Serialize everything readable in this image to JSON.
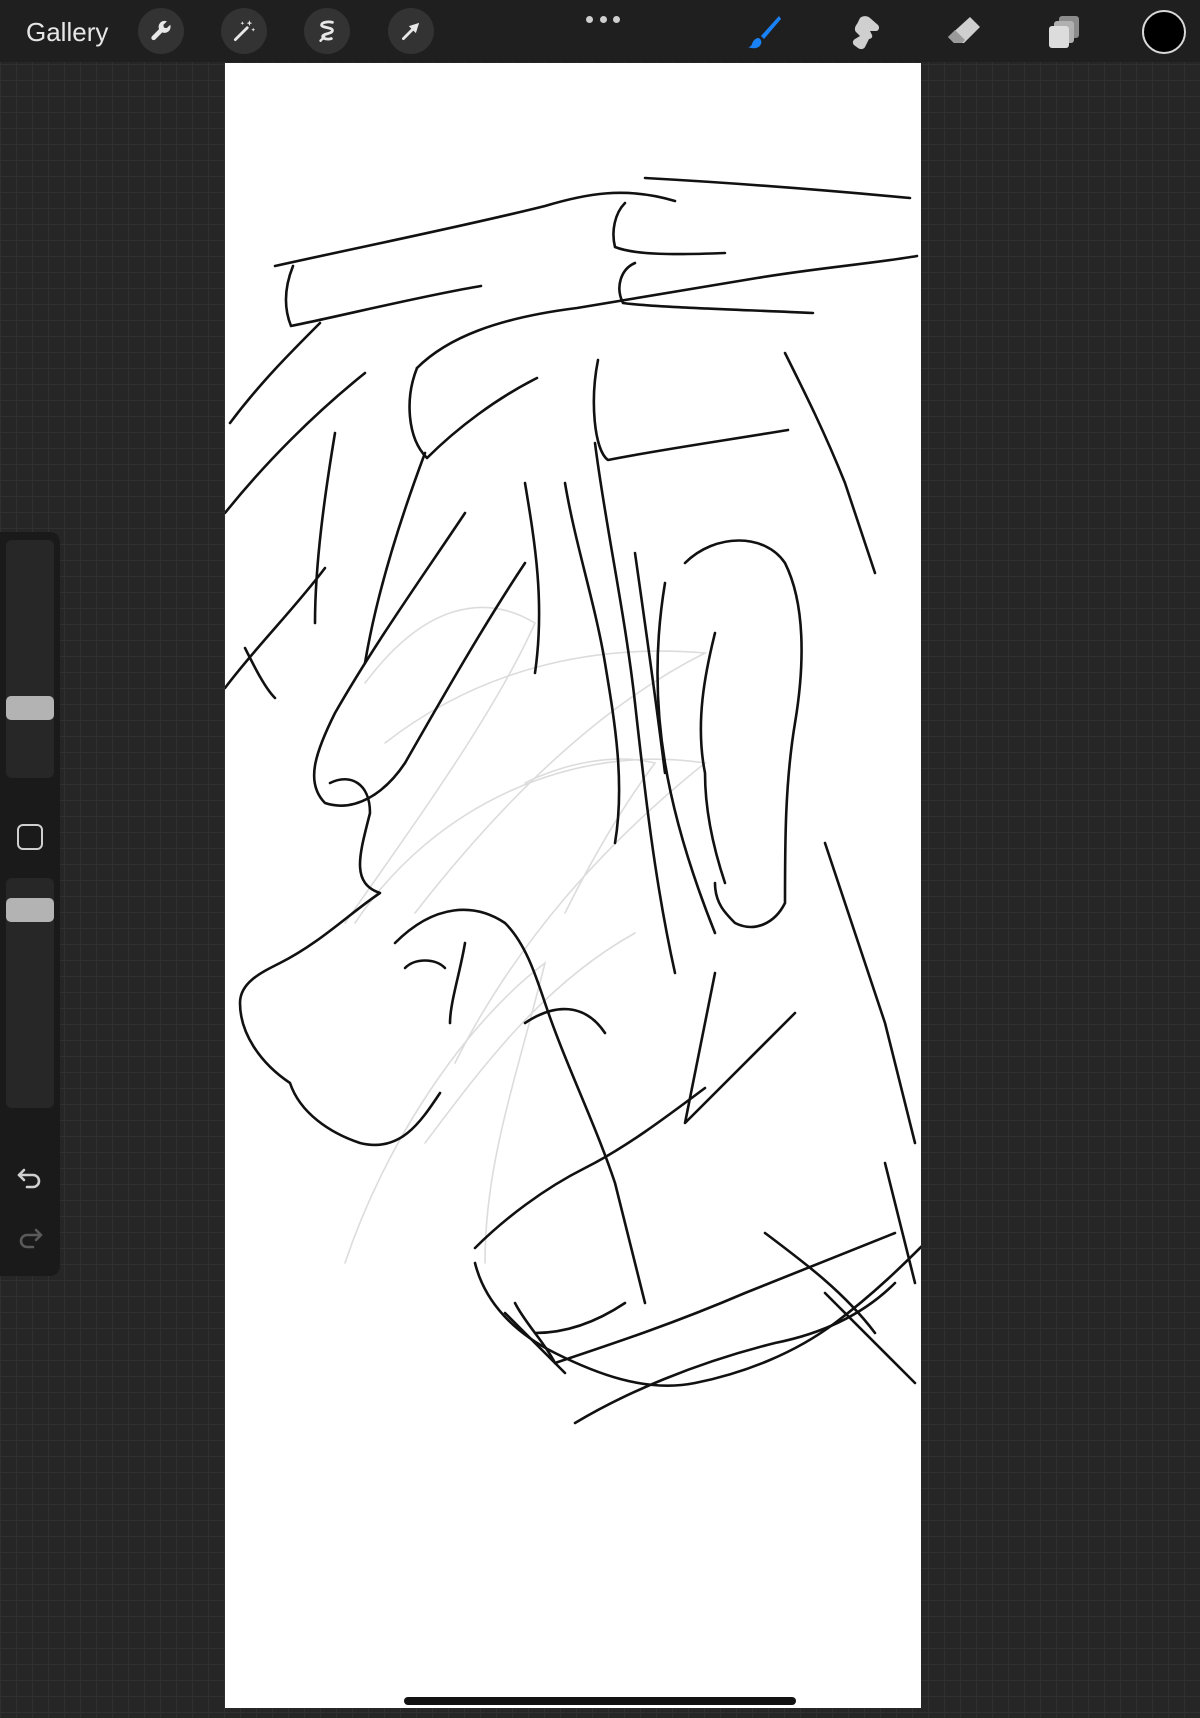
{
  "topbar": {
    "gallery_label": "Gallery",
    "tools_left": [
      "wrench-icon",
      "magic-wand-icon",
      "selection-icon",
      "transform-arrow-icon"
    ],
    "tools_right": [
      "brush-icon",
      "smudge-icon",
      "eraser-icon",
      "layers-icon"
    ],
    "active_tool": "brush-icon",
    "active_color": "#1a82f7",
    "current_color": "#000000"
  },
  "sidebar": {
    "brush_size_slider": {
      "level": 0.31
    },
    "opacity_slider": {
      "level": 0.95
    },
    "undo_icon": "undo-icon",
    "redo_icon": "redo-icon"
  },
  "canvas": {
    "background": "#ffffff",
    "stroke_color": "#111111",
    "sketch_color": "#d9d9d9"
  }
}
